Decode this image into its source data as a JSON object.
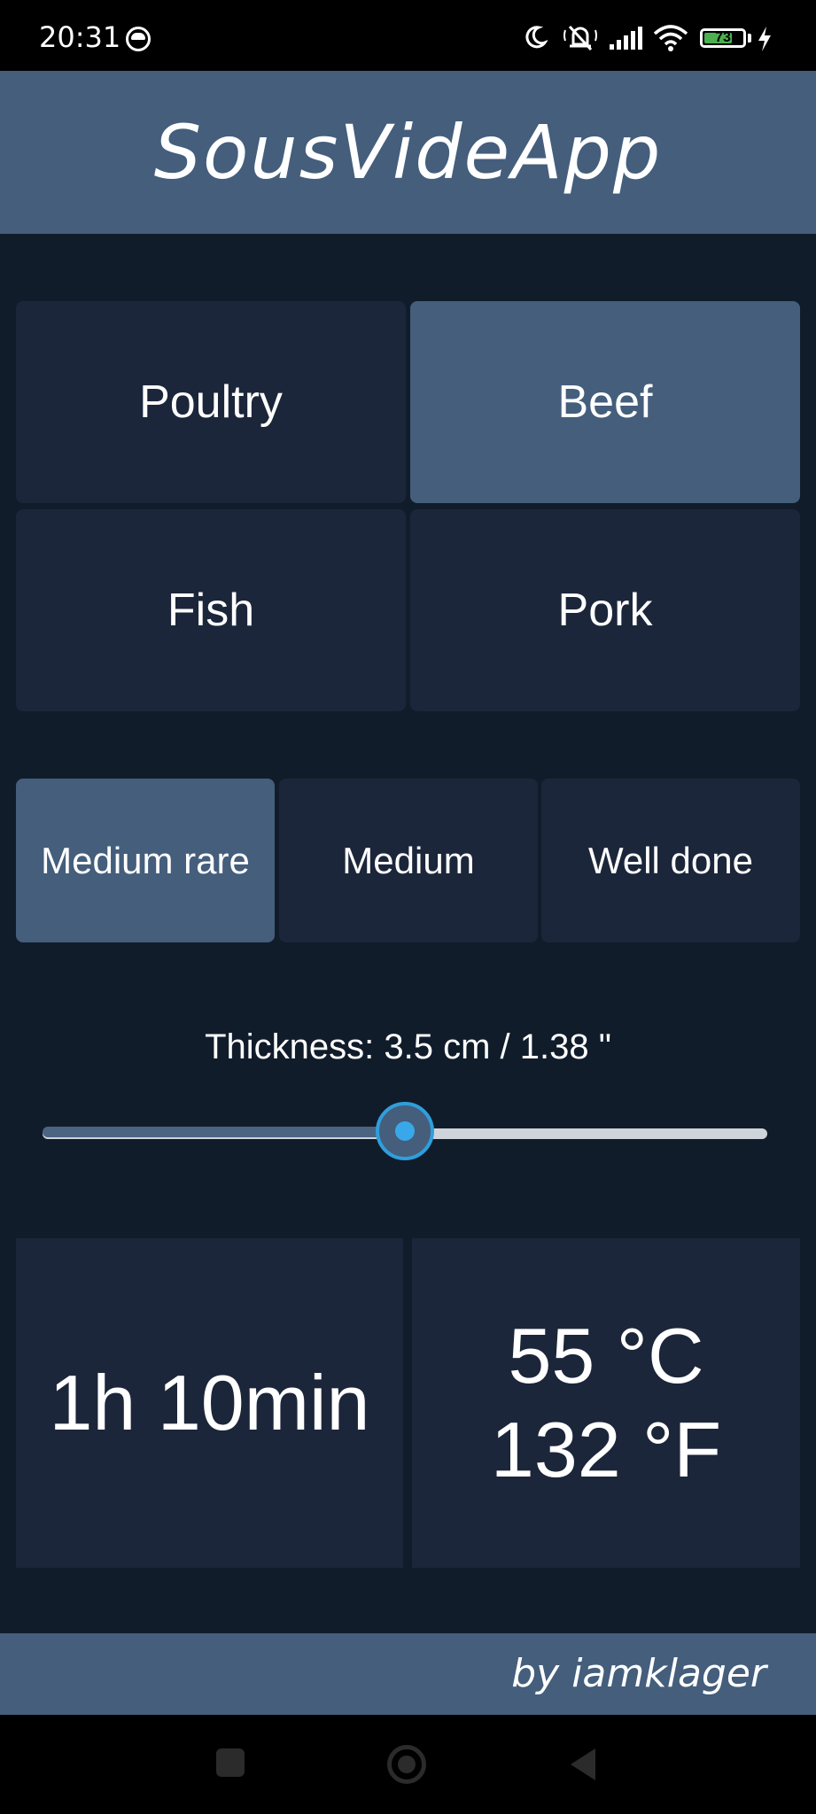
{
  "status_bar": {
    "time": "20:31",
    "battery_level": "73",
    "battery_fraction": 0.73,
    "icons": [
      "face-notification-icon",
      "moon-icon",
      "bell-muted-icon",
      "signal-icon",
      "wifi-icon",
      "battery-icon",
      "charging-bolt-icon"
    ]
  },
  "app": {
    "title": "SousVideApp",
    "footer": "by iamklager"
  },
  "meat_types": [
    {
      "label": "Poultry",
      "selected": false
    },
    {
      "label": "Beef",
      "selected": true
    },
    {
      "label": "Fish",
      "selected": false
    },
    {
      "label": "Pork",
      "selected": false
    }
  ],
  "doneness": [
    {
      "label": "Medium rare",
      "selected": true
    },
    {
      "label": "Medium",
      "selected": false
    },
    {
      "label": "Well done",
      "selected": false
    }
  ],
  "thickness": {
    "label": "Thickness: 3.5 cm / 1.38 \"",
    "slider_fraction": 0.5
  },
  "result": {
    "time": "1h 10min",
    "temp_c": "55 °C",
    "temp_f": "132 °F"
  },
  "colors": {
    "background": "#111c2b",
    "header": "#445e7c",
    "tile": "#1c263a",
    "tile_selected": "#445e7c",
    "slider_accent": "#39a8ea"
  }
}
